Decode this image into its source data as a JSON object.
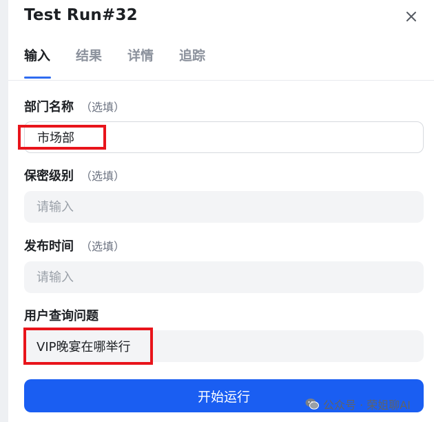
{
  "dialog": {
    "title": "Test Run#32"
  },
  "tabs": [
    {
      "label": "输入",
      "active": true
    },
    {
      "label": "结果",
      "active": false
    },
    {
      "label": "详情",
      "active": false
    },
    {
      "label": "追踪",
      "active": false
    }
  ],
  "fields": [
    {
      "label": "部门名称",
      "optional": "（选填）",
      "value": "市场部",
      "placeholder": ""
    },
    {
      "label": "保密级别",
      "optional": "（选填）",
      "value": "",
      "placeholder": "请输入"
    },
    {
      "label": "发布时间",
      "optional": "（选填）",
      "value": "",
      "placeholder": "请输入"
    },
    {
      "label": "用户查询问题",
      "value": "VIP晚宴在哪举行",
      "placeholder": ""
    }
  ],
  "run_button": {
    "label": "开始运行"
  },
  "watermark": {
    "text": "公众号 · 荣姐聊AI"
  },
  "colors": {
    "accent": "#1a5ef2",
    "highlight_box": "#e8141b",
    "tab_underline": "#2f6bf0"
  }
}
